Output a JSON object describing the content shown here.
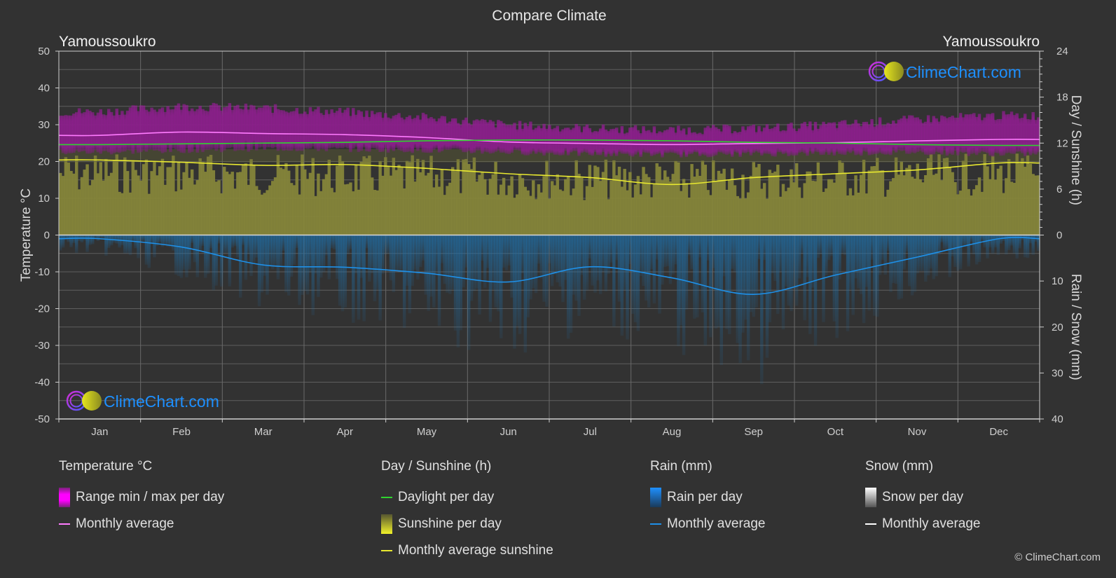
{
  "chart_data": {
    "type": "area",
    "title": "Compare Climate",
    "location_left": "Yamoussoukro",
    "location_right": "Yamoussoukro",
    "categories": [
      "Jan",
      "Feb",
      "Mar",
      "Apr",
      "May",
      "Jun",
      "Jul",
      "Aug",
      "Sep",
      "Oct",
      "Nov",
      "Dec"
    ],
    "y_left": {
      "label": "Temperature °C",
      "range": [
        -50,
        50
      ],
      "ticks": [
        50,
        40,
        30,
        20,
        10,
        0,
        -10,
        -20,
        -30,
        -40,
        -50
      ]
    },
    "y_right_top": {
      "label": "Day / Sunshine (h)",
      "range": [
        0,
        24
      ],
      "ticks": [
        24,
        18,
        12,
        6,
        0
      ]
    },
    "y_right_bottom": {
      "label": "Rain / Snow (mm)",
      "range": [
        0,
        40
      ],
      "ticks": [
        0,
        10,
        20,
        30,
        40
      ]
    },
    "grid": true,
    "series": [
      {
        "name": "Temperature range min / max per day",
        "kind": "band",
        "color": "#d21bd2",
        "min": [
          22.5,
          23.0,
          23.5,
          23.3,
          23.0,
          22.5,
          22.0,
          21.8,
          22.0,
          22.2,
          22.5,
          22.0
        ],
        "max": [
          33.5,
          35.0,
          34.5,
          33.5,
          32.0,
          30.0,
          29.0,
          28.5,
          29.0,
          30.0,
          31.5,
          32.5
        ]
      },
      {
        "name": "Temperature monthly average",
        "kind": "line",
        "color": "#ff7bff",
        "axis": "temp",
        "values": [
          27.1,
          28.0,
          27.6,
          27.3,
          26.5,
          25.3,
          24.9,
          24.6,
          24.9,
          25.1,
          25.6,
          26.0
        ]
      },
      {
        "name": "Daylight per day",
        "kind": "line",
        "color": "#2fd42f",
        "axis": "sun",
        "values": [
          11.8,
          11.9,
          12.0,
          12.1,
          12.3,
          12.4,
          12.4,
          12.3,
          12.1,
          12.0,
          11.8,
          11.7
        ]
      },
      {
        "name": "Sunshine per day",
        "kind": "area",
        "color": "#8a8a35",
        "axis": "sun",
        "values": [
          10.8,
          10.8,
          10.6,
          10.5,
          10.4,
          10.2,
          10.0,
          9.8,
          10.0,
          10.2,
          10.5,
          10.7
        ]
      },
      {
        "name": "Monthly average sunshine",
        "kind": "line",
        "color": "#e8e830",
        "axis": "sun",
        "values": [
          9.8,
          9.5,
          9.1,
          9.2,
          8.7,
          8.0,
          7.5,
          6.6,
          7.5,
          8.0,
          8.5,
          9.4
        ]
      },
      {
        "name": "Rain per day",
        "kind": "bars",
        "color": "#1f6fa8",
        "axis": "rain",
        "values": [
          2.0,
          4.5,
          8.0,
          9.0,
          11.0,
          13.0,
          10.0,
          12.0,
          16.0,
          11.0,
          6.5,
          2.5
        ]
      },
      {
        "name": "Rain monthly average",
        "kind": "line",
        "color": "#1e90e8",
        "axis": "rain",
        "values": [
          0.8,
          2.6,
          6.5,
          7.0,
          8.3,
          10.2,
          6.9,
          9.3,
          12.9,
          8.7,
          4.8,
          0.8
        ]
      },
      {
        "name": "Snow monthly average",
        "kind": "line",
        "color": "#ffffff",
        "axis": "rain",
        "values": [
          0,
          0,
          0,
          0,
          0,
          0,
          0,
          0,
          0,
          0,
          0,
          0
        ]
      }
    ]
  },
  "watermark": "ClimeChart.com",
  "legend": {
    "temperature": {
      "title": "Temperature °C",
      "items": [
        "Range min / max per day",
        "Monthly average"
      ]
    },
    "sunshine": {
      "title": "Day / Sunshine (h)",
      "items": [
        "Daylight per day",
        "Sunshine per day",
        "Monthly average sunshine"
      ]
    },
    "rain": {
      "title": "Rain (mm)",
      "items": [
        "Rain per day",
        "Monthly average"
      ]
    },
    "snow": {
      "title": "Snow (mm)",
      "items": [
        "Snow per day",
        "Monthly average"
      ]
    }
  },
  "colors": {
    "background": "#323232",
    "grid": "#5a5a5a",
    "text": "#e0e0e0",
    "brand": "#1e90ff"
  },
  "copyright": "© ClimeChart.com"
}
